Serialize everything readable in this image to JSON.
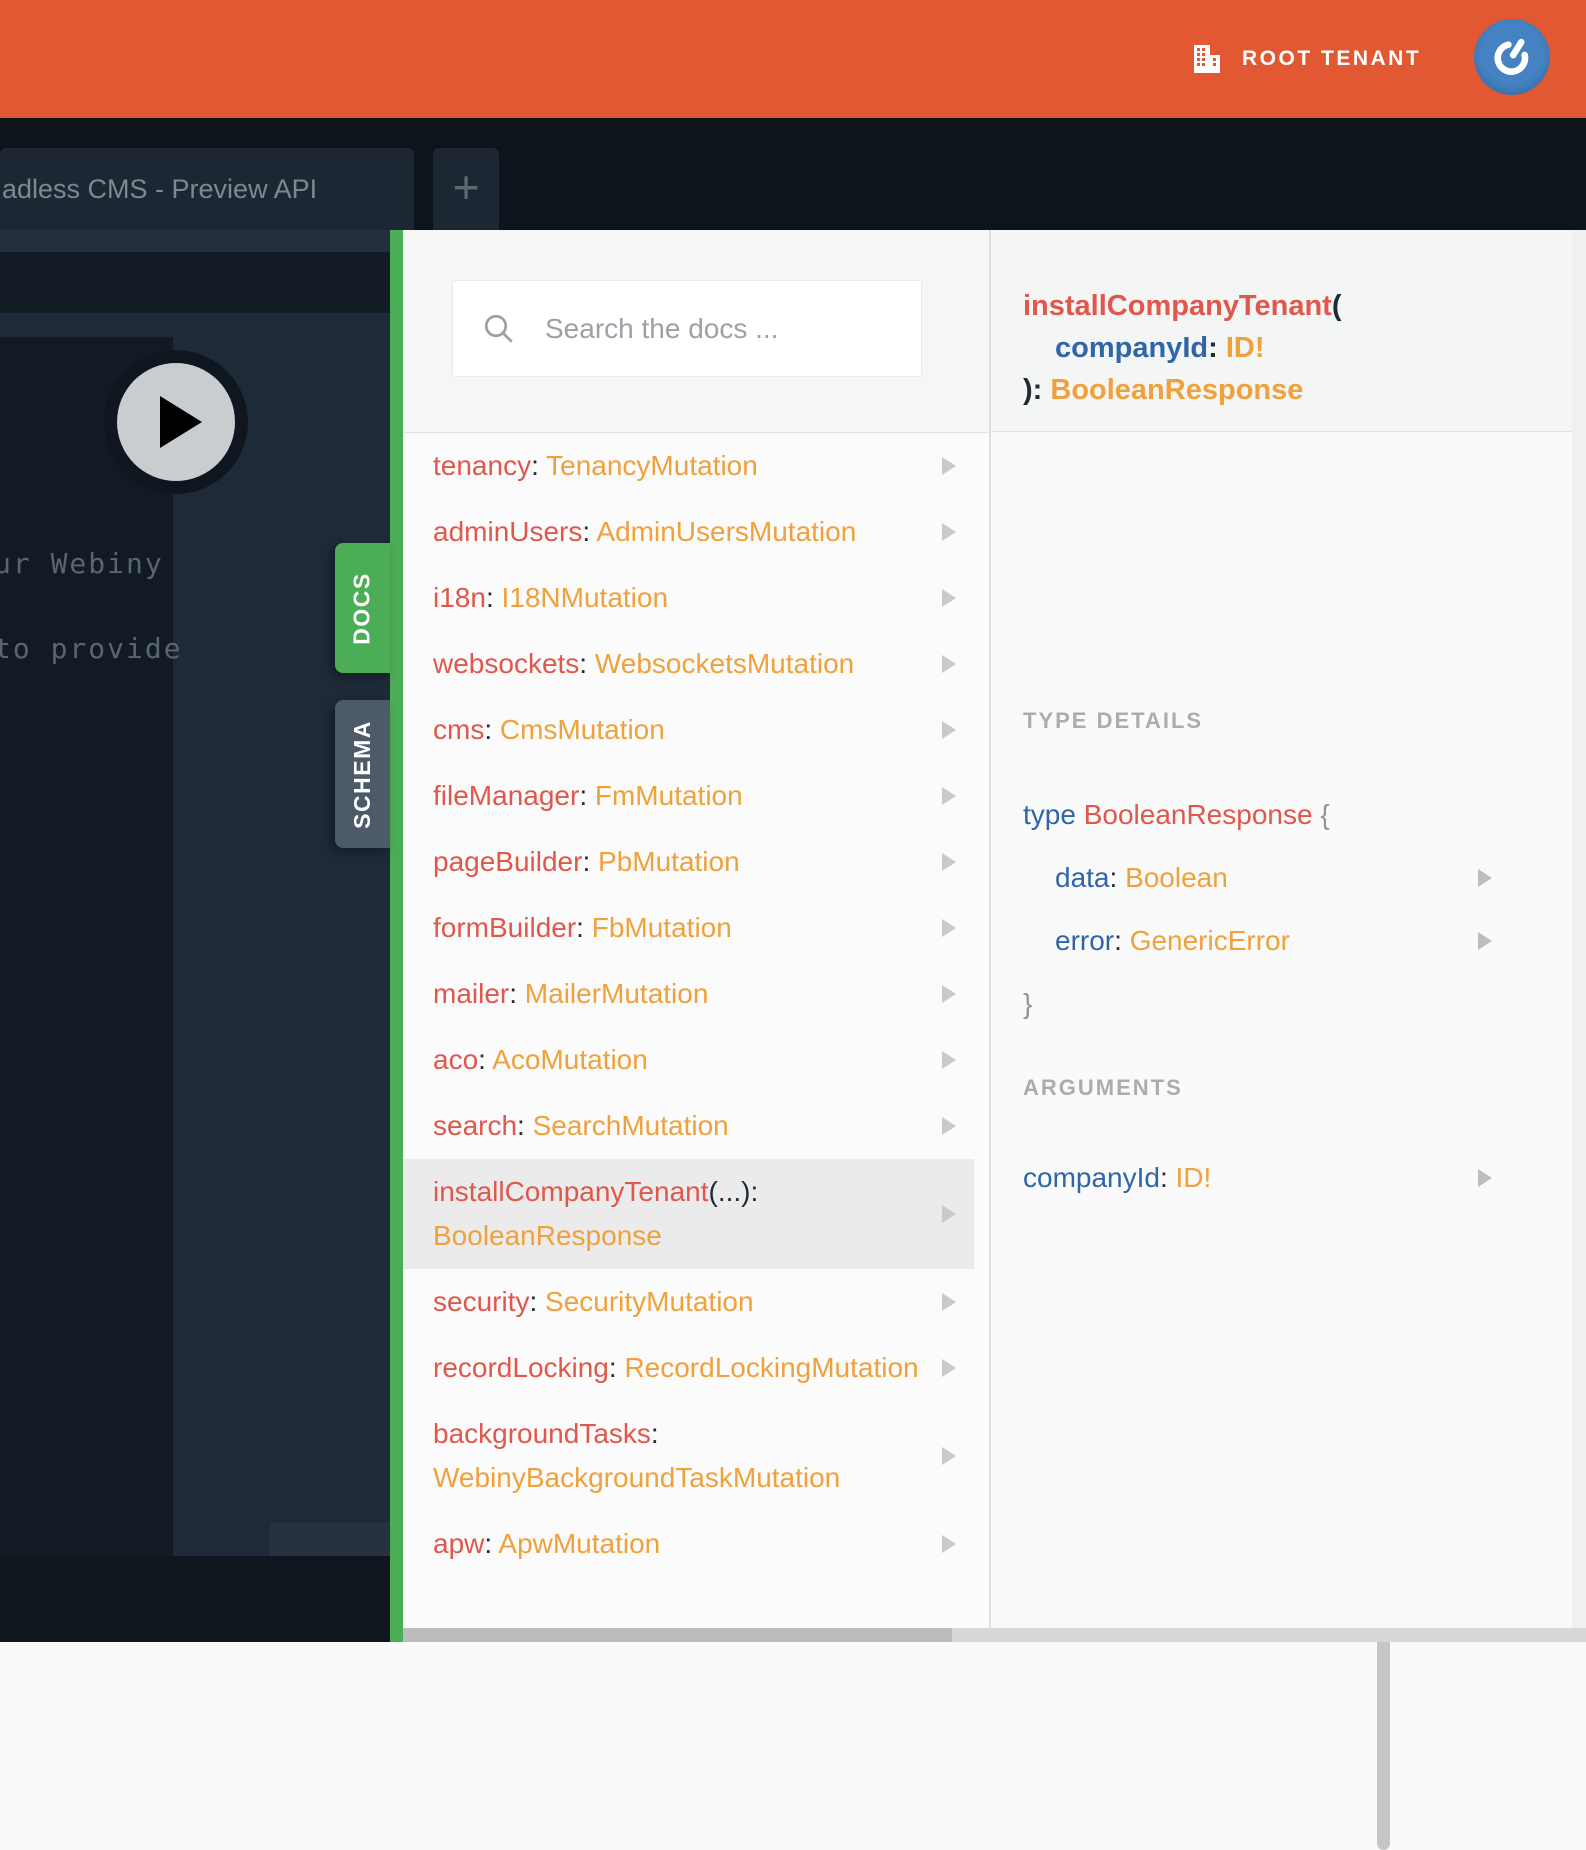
{
  "header": {
    "tenant_label": "ROOT TENANT"
  },
  "tab_bar": {
    "active_tab_title": "adless CMS - Preview API",
    "new_tab_label": "+"
  },
  "editor": {
    "visible_code_lines": [
      "ur Webiny",
      "to provide"
    ]
  },
  "side_tabs": {
    "docs_label": "DOCS",
    "schema_label": "SCHEMA"
  },
  "docs": {
    "search_placeholder": "Search the docs ...",
    "fields": [
      {
        "name": "tenancy",
        "type": "TenancyMutation"
      },
      {
        "name": "adminUsers",
        "type": "AdminUsersMutation"
      },
      {
        "name": "i18n",
        "type": "I18NMutation"
      },
      {
        "name": "websockets",
        "type": "WebsocketsMutation"
      },
      {
        "name": "cms",
        "type": "CmsMutation"
      },
      {
        "name": "fileManager",
        "type": "FmMutation"
      },
      {
        "name": "pageBuilder",
        "type": "PbMutation"
      },
      {
        "name": "formBuilder",
        "type": "FbMutation"
      },
      {
        "name": "mailer",
        "type": "MailerMutation"
      },
      {
        "name": "aco",
        "type": "AcoMutation"
      },
      {
        "name": "search",
        "type": "SearchMutation"
      },
      {
        "name": "installCompanyTenant",
        "args": "(...)",
        "type": "BooleanResponse",
        "highlighted": true
      },
      {
        "name": "security",
        "type": "SecurityMutation"
      },
      {
        "name": "recordLocking",
        "type": "RecordLockingMutation"
      },
      {
        "name": "backgroundTasks",
        "type": "WebinyBackgroundTaskMutation"
      },
      {
        "name": "apw",
        "type": "ApwMutation"
      }
    ]
  },
  "detail": {
    "signature": {
      "name": "installCompanyTenant",
      "paren_open": "(",
      "arg_name": "companyId",
      "colon": ": ",
      "arg_type": "ID!",
      "paren_close": "): ",
      "return_type": "BooleanResponse"
    },
    "section_type_details": "TYPE DETAILS",
    "section_arguments": "ARGUMENTS",
    "type_block": {
      "keyword": "type ",
      "name": "BooleanResponse",
      "brace_open": " {",
      "fields": [
        {
          "name": "data",
          "colon": ": ",
          "type": "Boolean"
        },
        {
          "name": "error",
          "colon": ": ",
          "type": "GenericError"
        }
      ],
      "brace_close": "}"
    },
    "argument": {
      "name": "companyId",
      "colon": ": ",
      "type": "ID!"
    }
  },
  "colors": {
    "header_orange": "#E25833",
    "docs_green": "#4CAD57",
    "field_red": "#E0574C",
    "type_orange": "#EFA13C",
    "keyword_blue": "#2E66A8",
    "highlight_row": "#EBEBEB"
  }
}
